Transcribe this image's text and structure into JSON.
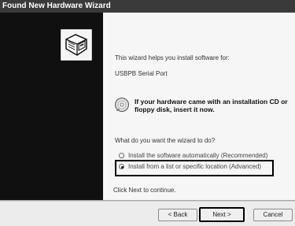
{
  "window": {
    "title": "Found New Hardware Wizard"
  },
  "sidebar": {
    "icon": "hardware-wizard-icon"
  },
  "content": {
    "intro": "This wizard helps you install software for:",
    "device_name": "USBPB Serial Port",
    "cd_icon": "cd-icon",
    "cd_message": "If your hardware came with an installation CD or floppy disk, insert it now.",
    "question": "What do you want the wizard to do?",
    "options": [
      {
        "label": "Install the software automatically (Recommended)",
        "selected": false
      },
      {
        "label": "Install from a list or specific location (Advanced)",
        "selected": true
      }
    ],
    "footer_note": "Click Next to continue."
  },
  "buttons": {
    "back": "< Back",
    "next": "Next >",
    "cancel": "Cancel"
  }
}
